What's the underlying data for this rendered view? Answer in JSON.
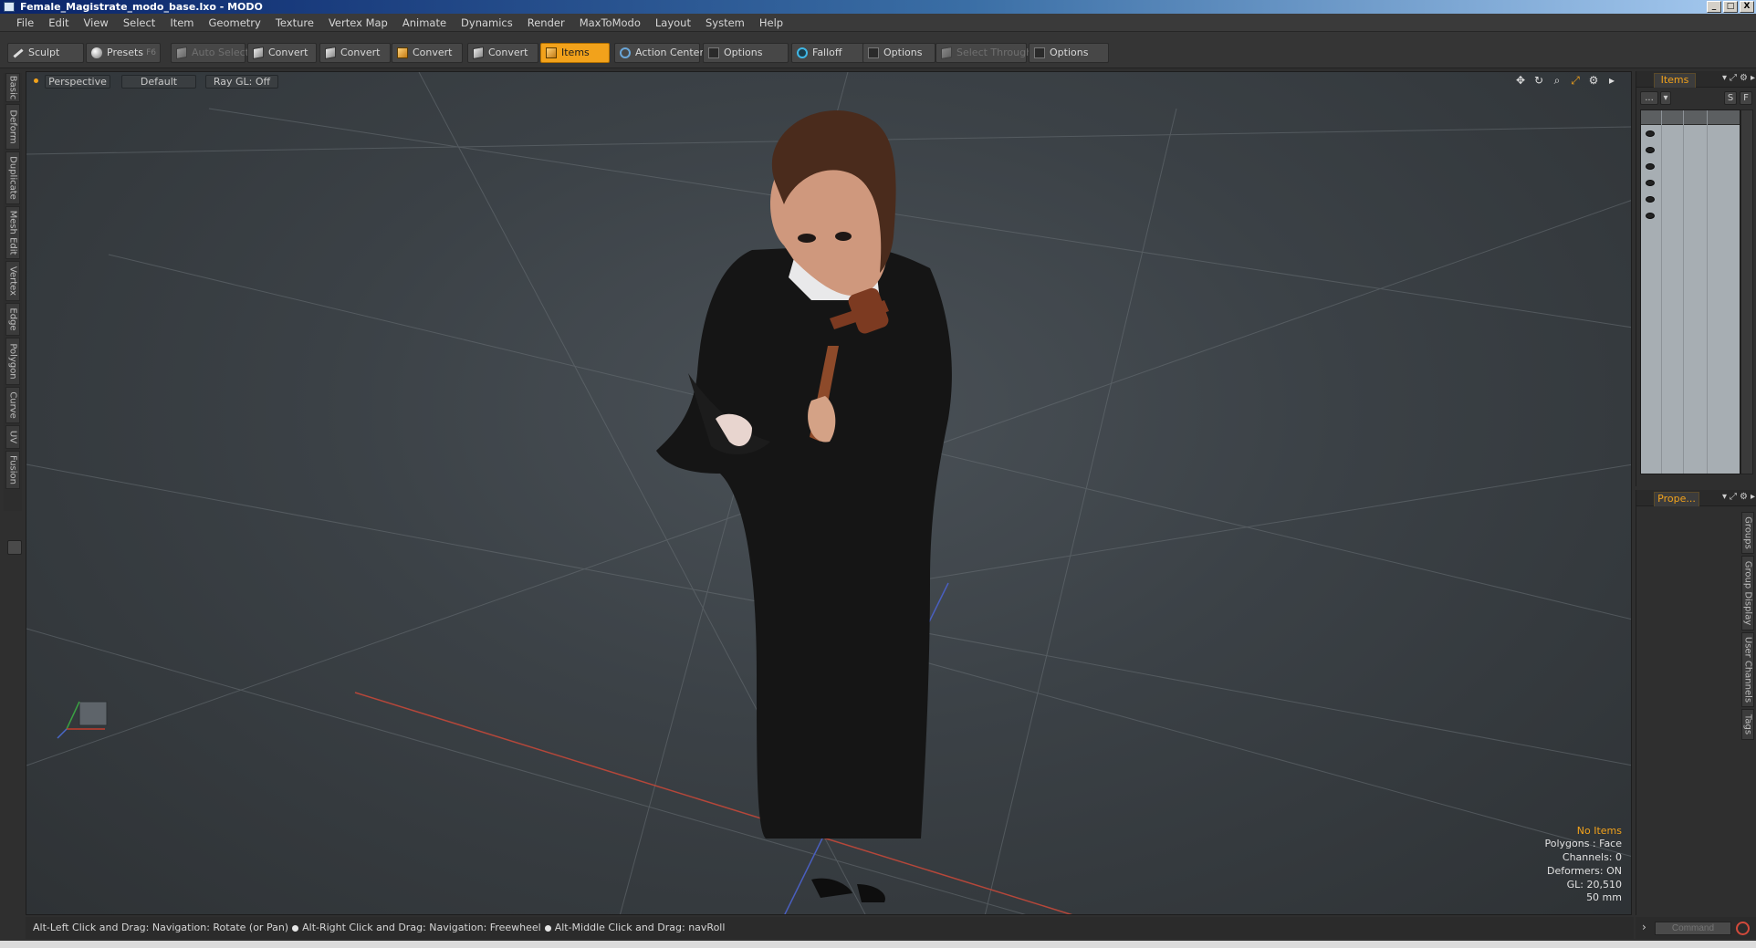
{
  "window": {
    "title": "Female_Magistrate_modo_base.lxo - MODO",
    "buttons": [
      "_",
      "□",
      "X"
    ]
  },
  "menu": [
    "File",
    "Edit",
    "View",
    "Select",
    "Item",
    "Geometry",
    "Texture",
    "Vertex Map",
    "Animate",
    "Dynamics",
    "Render",
    "MaxToModo",
    "Layout",
    "System",
    "Help"
  ],
  "toolbar": {
    "sculpt": "Sculpt",
    "presets": "Presets",
    "presets_hint": "F6",
    "auto_select": "Auto Select",
    "convert1": "Convert",
    "convert2": "Convert",
    "convert3": "Convert",
    "convert4": "Convert",
    "items": "Items",
    "action_center": "Action Center",
    "options1": "Options",
    "falloff": "Falloff",
    "options2": "Options",
    "select_through": "Select Through",
    "options3": "Options"
  },
  "left_tabs": [
    "Basic",
    "Deform",
    "Duplicate",
    "Mesh Edit",
    "Vertex",
    "Edge",
    "Polygon",
    "Curve",
    "UV",
    "Fusion"
  ],
  "viewport": {
    "view": "Perspective",
    "shading": "Default",
    "raygl": "Ray GL: Off",
    "info": {
      "selection": "No Items",
      "polygons": "Polygons : Face",
      "channels": "Channels: 0",
      "deformers": "Deformers: ON",
      "gl": "GL: 20,510",
      "lens": "50 mm"
    },
    "axis": {
      "x": "X",
      "y": "Y",
      "z": "Z"
    }
  },
  "items_panel": {
    "tab": "Items",
    "btn_more": "...",
    "btn_s": "S",
    "btn_f": "F",
    "rows": 6
  },
  "properties_panel": {
    "tab": "Prope...",
    "side_tabs": [
      "Groups",
      "Group Display",
      "User Channels",
      "Tags"
    ]
  },
  "status": {
    "hint1": "Alt-Left Click and Drag: Navigation: Rotate (or Pan)",
    "hint2": "Alt-Right Click and Drag: Navigation: Freewheel",
    "hint3": "Alt-Middle Click and Drag: navRoll"
  },
  "command": {
    "placeholder": "Command"
  },
  "colors": {
    "accent": "#f2a21b",
    "title_gradient_start": "#0a246a",
    "viewport_bg": "#3b4146"
  }
}
